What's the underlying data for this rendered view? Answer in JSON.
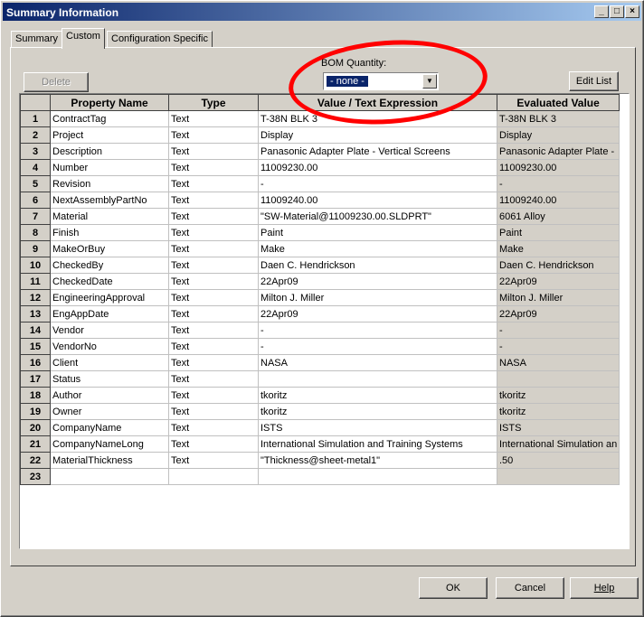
{
  "window": {
    "title": "Summary Information",
    "min": "_",
    "max": "□",
    "close": "×"
  },
  "tabs": [
    {
      "label": "Summary"
    },
    {
      "label": "Custom"
    },
    {
      "label": "Configuration Specific"
    }
  ],
  "toolbar": {
    "delete_label": "Delete",
    "edit_list_label": "Edit List",
    "bom_label": "BOM Quantity:",
    "bom_value": "- none -"
  },
  "table": {
    "headers": [
      "Property Name",
      "Type",
      "Value / Text Expression",
      "Evaluated Value"
    ],
    "rows": [
      {
        "n": "1",
        "name": "ContractTag",
        "type": "Text",
        "value": "T-38N BLK 3",
        "eval": "T-38N BLK 3"
      },
      {
        "n": "2",
        "name": "Project",
        "type": "Text",
        "value": "Display",
        "eval": "Display"
      },
      {
        "n": "3",
        "name": "Description",
        "type": "Text",
        "value": "Panasonic Adapter Plate - Vertical Screens",
        "eval": "Panasonic Adapter Plate -"
      },
      {
        "n": "4",
        "name": "Number",
        "type": "Text",
        "value": "11009230.00",
        "eval": "11009230.00"
      },
      {
        "n": "5",
        "name": "Revision",
        "type": "Text",
        "value": "-",
        "eval": "-"
      },
      {
        "n": "6",
        "name": "NextAssemblyPartNo",
        "type": "Text",
        "value": "11009240.00",
        "eval": "11009240.00"
      },
      {
        "n": "7",
        "name": "Material",
        "type": "Text",
        "value": "\"SW-Material@11009230.00.SLDPRT\"",
        "eval": "6061 Alloy"
      },
      {
        "n": "8",
        "name": "Finish",
        "type": "Text",
        "value": "Paint",
        "eval": "Paint"
      },
      {
        "n": "9",
        "name": "MakeOrBuy",
        "type": "Text",
        "value": "Make",
        "eval": "Make"
      },
      {
        "n": "10",
        "name": "CheckedBy",
        "type": "Text",
        "value": "Daen C. Hendrickson",
        "eval": "Daen C. Hendrickson"
      },
      {
        "n": "11",
        "name": "CheckedDate",
        "type": "Text",
        "value": "22Apr09",
        "eval": "22Apr09"
      },
      {
        "n": "12",
        "name": "EngineeringApproval",
        "type": "Text",
        "value": "Milton J. Miller",
        "eval": "Milton J. Miller"
      },
      {
        "n": "13",
        "name": "EngAppDate",
        "type": "Text",
        "value": "22Apr09",
        "eval": "22Apr09"
      },
      {
        "n": "14",
        "name": "Vendor",
        "type": "Text",
        "value": "-",
        "eval": "-"
      },
      {
        "n": "15",
        "name": "VendorNo",
        "type": "Text",
        "value": "-",
        "eval": "-"
      },
      {
        "n": "16",
        "name": "Client",
        "type": "Text",
        "value": "NASA",
        "eval": "NASA"
      },
      {
        "n": "17",
        "name": "Status",
        "type": "Text",
        "value": "",
        "eval": ""
      },
      {
        "n": "18",
        "name": "Author",
        "type": "Text",
        "value": "tkoritz",
        "eval": "tkoritz"
      },
      {
        "n": "19",
        "name": "Owner",
        "type": "Text",
        "value": "tkoritz",
        "eval": "tkoritz"
      },
      {
        "n": "20",
        "name": "CompanyName",
        "type": "Text",
        "value": "ISTS",
        "eval": "ISTS"
      },
      {
        "n": "21",
        "name": "CompanyNameLong",
        "type": "Text",
        "value": "International Simulation and Training Systems",
        "eval": "International Simulation an"
      },
      {
        "n": "22",
        "name": "MaterialThickness",
        "type": "Text",
        "value": "\"Thickness@sheet-metal1\"",
        "eval": ".50"
      },
      {
        "n": "23",
        "name": "",
        "type": "",
        "value": "",
        "eval": ""
      }
    ]
  },
  "footer": {
    "ok_label": "OK",
    "cancel_label": "Cancel",
    "help_label": "Help"
  },
  "annotation_color": "#ff0000"
}
